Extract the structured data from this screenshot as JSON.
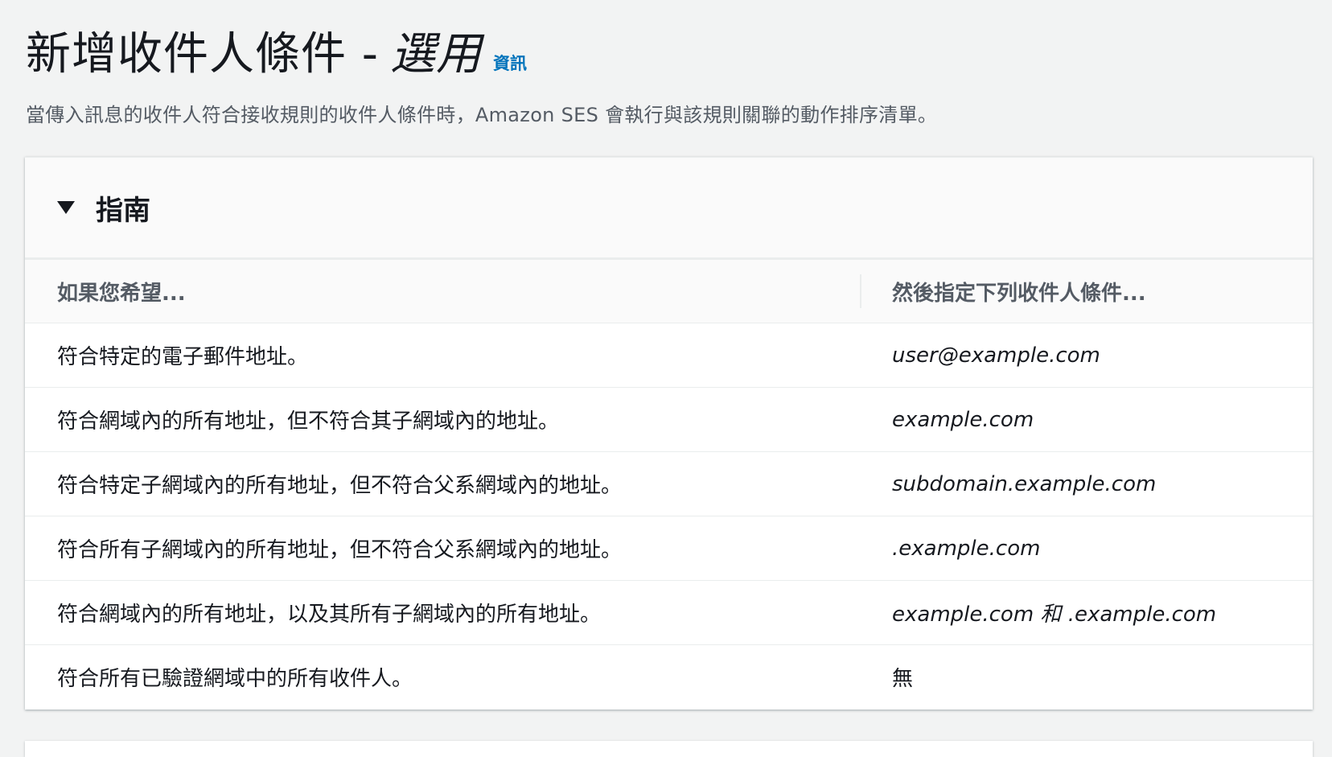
{
  "header": {
    "title": "新增收件人條件 -",
    "title_optional": "選用",
    "info_link": "資訊",
    "description": "當傳入訊息的收件人符合接收規則的收件人條件時，Amazon SES 會執行與該規則關聯的動作排序清單。"
  },
  "panel": {
    "title": "指南",
    "columns": [
      "如果您希望...",
      "然後指定下列收件人條件..."
    ],
    "rows": [
      {
        "want": "符合特定的電子郵件地址。",
        "condition": "user@example.com"
      },
      {
        "want": "符合網域內的所有地址，但不符合其子網域內的地址。",
        "condition": "example.com"
      },
      {
        "want": "符合特定子網域內的所有地址，但不符合父系網域內的地址。",
        "condition": "subdomain.example.com"
      },
      {
        "want": "符合所有子網域內的所有地址，但不符合父系網域內的地址。",
        "condition": ".example.com"
      },
      {
        "want": "符合網域內的所有地址，以及其所有子網域內的所有地址。",
        "condition": "example.com 和 .example.com"
      },
      {
        "want": "符合所有已驗證網域中的所有收件人。",
        "condition": "無"
      }
    ]
  },
  "colors": {
    "link": "#0073bb",
    "background": "#f2f3f3",
    "text": "#16191f",
    "secondary_text": "#545b64"
  },
  "icons": {
    "expand": "caret-down-icon"
  }
}
